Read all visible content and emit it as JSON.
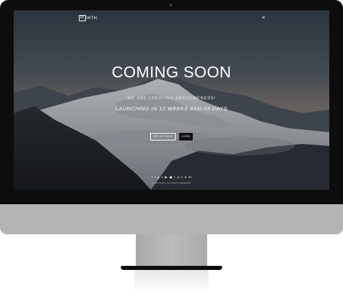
{
  "header": {
    "logo_box": "M",
    "logo_rest": "INTH",
    "menu_icon": "hamburger-icon"
  },
  "hero": {
    "title": "COMING SOON",
    "subtitle": "WE ARE CREATING AWESOMENESS!",
    "launch": "LAUNCHING IN 12 WEEKS AND 03 DAYS"
  },
  "buttons": {
    "get_in_touch": "GET IN TOUCH",
    "login": "LOGIN"
  },
  "social": {
    "icons": [
      "facebook-icon",
      "twitter-icon",
      "google-plus-icon",
      "skype-icon",
      "youtube-icon",
      "instagram-icon",
      "tumblr-icon",
      "pinterest-icon",
      "vimeo-icon",
      "flickr-icon",
      "email-icon"
    ],
    "glyphs": [
      "f",
      "t",
      "g",
      "s",
      "▶",
      "▣",
      "t",
      "p",
      "v",
      "●",
      "✉"
    ]
  },
  "footer": {
    "copyright": "© 2015 NINTH. ALL RIGHTS RESERVED"
  },
  "colors": {
    "bezel": "#0d0d0e",
    "chin": "#b4b4b4",
    "text": "#ffffff"
  }
}
